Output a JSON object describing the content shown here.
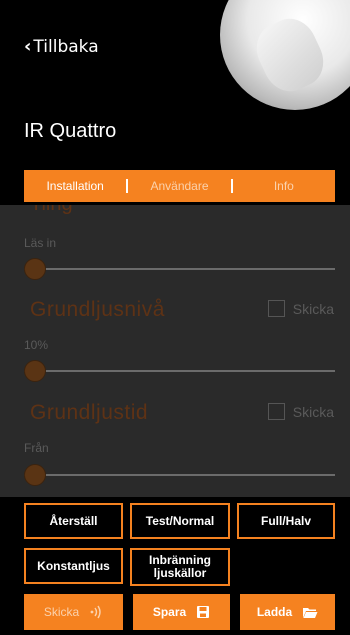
{
  "header": {
    "back_label": "Tillbaka",
    "title": "IR Quattro"
  },
  "tabs": [
    {
      "label": "Installation",
      "active": true
    },
    {
      "label": "Användare",
      "active": false
    },
    {
      "label": "Info",
      "active": false
    }
  ],
  "sections": {
    "partial_title": "Tiing",
    "partial_sub": "Läs in",
    "base_level": {
      "title": "Grundljusnivå",
      "send_label": "Skicka",
      "value": "10%"
    },
    "base_time": {
      "title": "Grundljustid",
      "send_label": "Skicka",
      "value": "Från"
    }
  },
  "buttons": {
    "reset": "Återställ",
    "test_normal": "Test/Normal",
    "full_half": "Full/Halv",
    "constant_light": "Konstantljus",
    "burn_in": "Inbränning ljuskällor",
    "send": "Skicka",
    "save": "Spara",
    "load": "Ladda"
  },
  "colors": {
    "accent": "#f58220",
    "background": "#000000",
    "panel": "#2a2a2a"
  }
}
